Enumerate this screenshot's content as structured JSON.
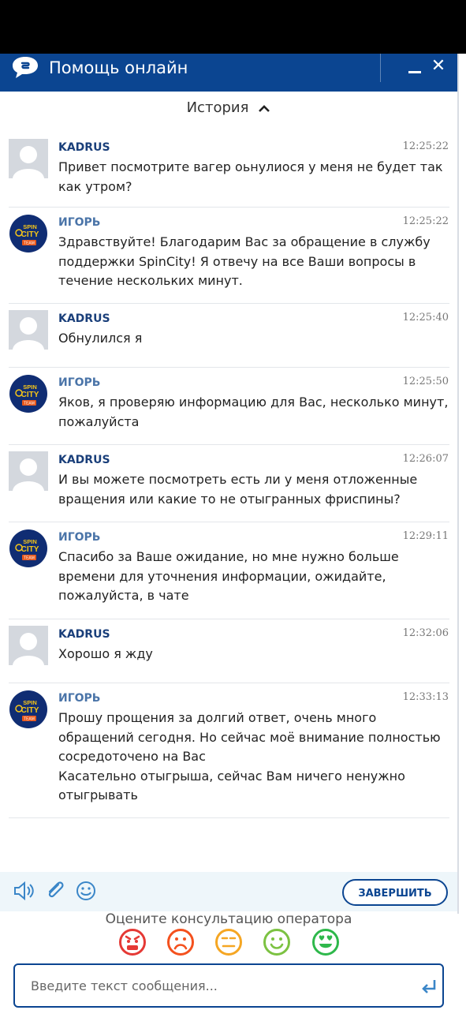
{
  "header": {
    "title": "Помощь онлайн"
  },
  "history": {
    "label": "История"
  },
  "messages": [
    {
      "author": "KADRUS",
      "role": "user",
      "time": "12:25:22",
      "lines": [
        "Привет посмотрите вагер оьнулиося у меня не будет так",
        "как утром?"
      ]
    },
    {
      "author": "ИГОРЬ",
      "role": "operator",
      "time": "12:25:22",
      "lines": [
        "Здравствуйте! Благодарим Вас за обращение в службу",
        "поддержки SpinCity! Я отвечу на все Ваши вопросы в",
        "течение нескольких минут."
      ]
    },
    {
      "author": "KADRUS",
      "role": "user",
      "time": "12:25:40",
      "lines": [
        "Обнулился я"
      ]
    },
    {
      "author": "ИГОРЬ",
      "role": "operator",
      "time": "12:25:50",
      "lines": [
        "Яков, я проверяю информацию для Вас, несколько минут,",
        "пожалуйста"
      ]
    },
    {
      "author": "KADRUS",
      "role": "user",
      "time": "12:26:07",
      "lines": [
        "И вы можете посмотреть есть ли у меня отложенные",
        "вращения или какие то не отыгранных фриспины?"
      ]
    },
    {
      "author": "ИГОРЬ",
      "role": "operator",
      "time": "12:29:11",
      "lines": [
        "Спасибо за Ваше ожидание, но мне нужно больше",
        "времени для уточнения информации, ожидайте,",
        "пожалуйста, в чате"
      ]
    },
    {
      "author": "KADRUS",
      "role": "user",
      "time": "12:32:06",
      "lines": [
        "Хорошо я жду"
      ]
    },
    {
      "author": "ИГОРЬ",
      "role": "operator",
      "time": "12:33:13",
      "lines": [
        "Прошу прощения за долгий ответ, очень много",
        "обращений сегодня. Но сейчас моё внимание полностью",
        "сосредоточено на Вас",
        "Касательно отыгрыша, сейчас Вам ничего ненужно",
        "отыгрывать"
      ]
    }
  ],
  "toolbar": {
    "icons": [
      "speaker-icon",
      "paperclip-icon",
      "smiley-icon"
    ],
    "finish_label": "ЗАВЕРШИТЬ"
  },
  "rating": {
    "prompt": "Оцените консультацию оператора",
    "faces": [
      {
        "name": "angry",
        "color": "#e53935"
      },
      {
        "name": "sad",
        "color": "#f4511e"
      },
      {
        "name": "neutral",
        "color": "#f5a623"
      },
      {
        "name": "happy",
        "color": "#7cc242"
      },
      {
        "name": "love",
        "color": "#2eb84b"
      }
    ]
  },
  "composer": {
    "placeholder": "Введите текст сообщения..."
  },
  "operator_avatar": {
    "line1": "SPIN",
    "line2": "CITY",
    "badge": "TEAM"
  },
  "colors": {
    "brand": "#0b4591",
    "toolbar_bg": "#eef6fa"
  }
}
